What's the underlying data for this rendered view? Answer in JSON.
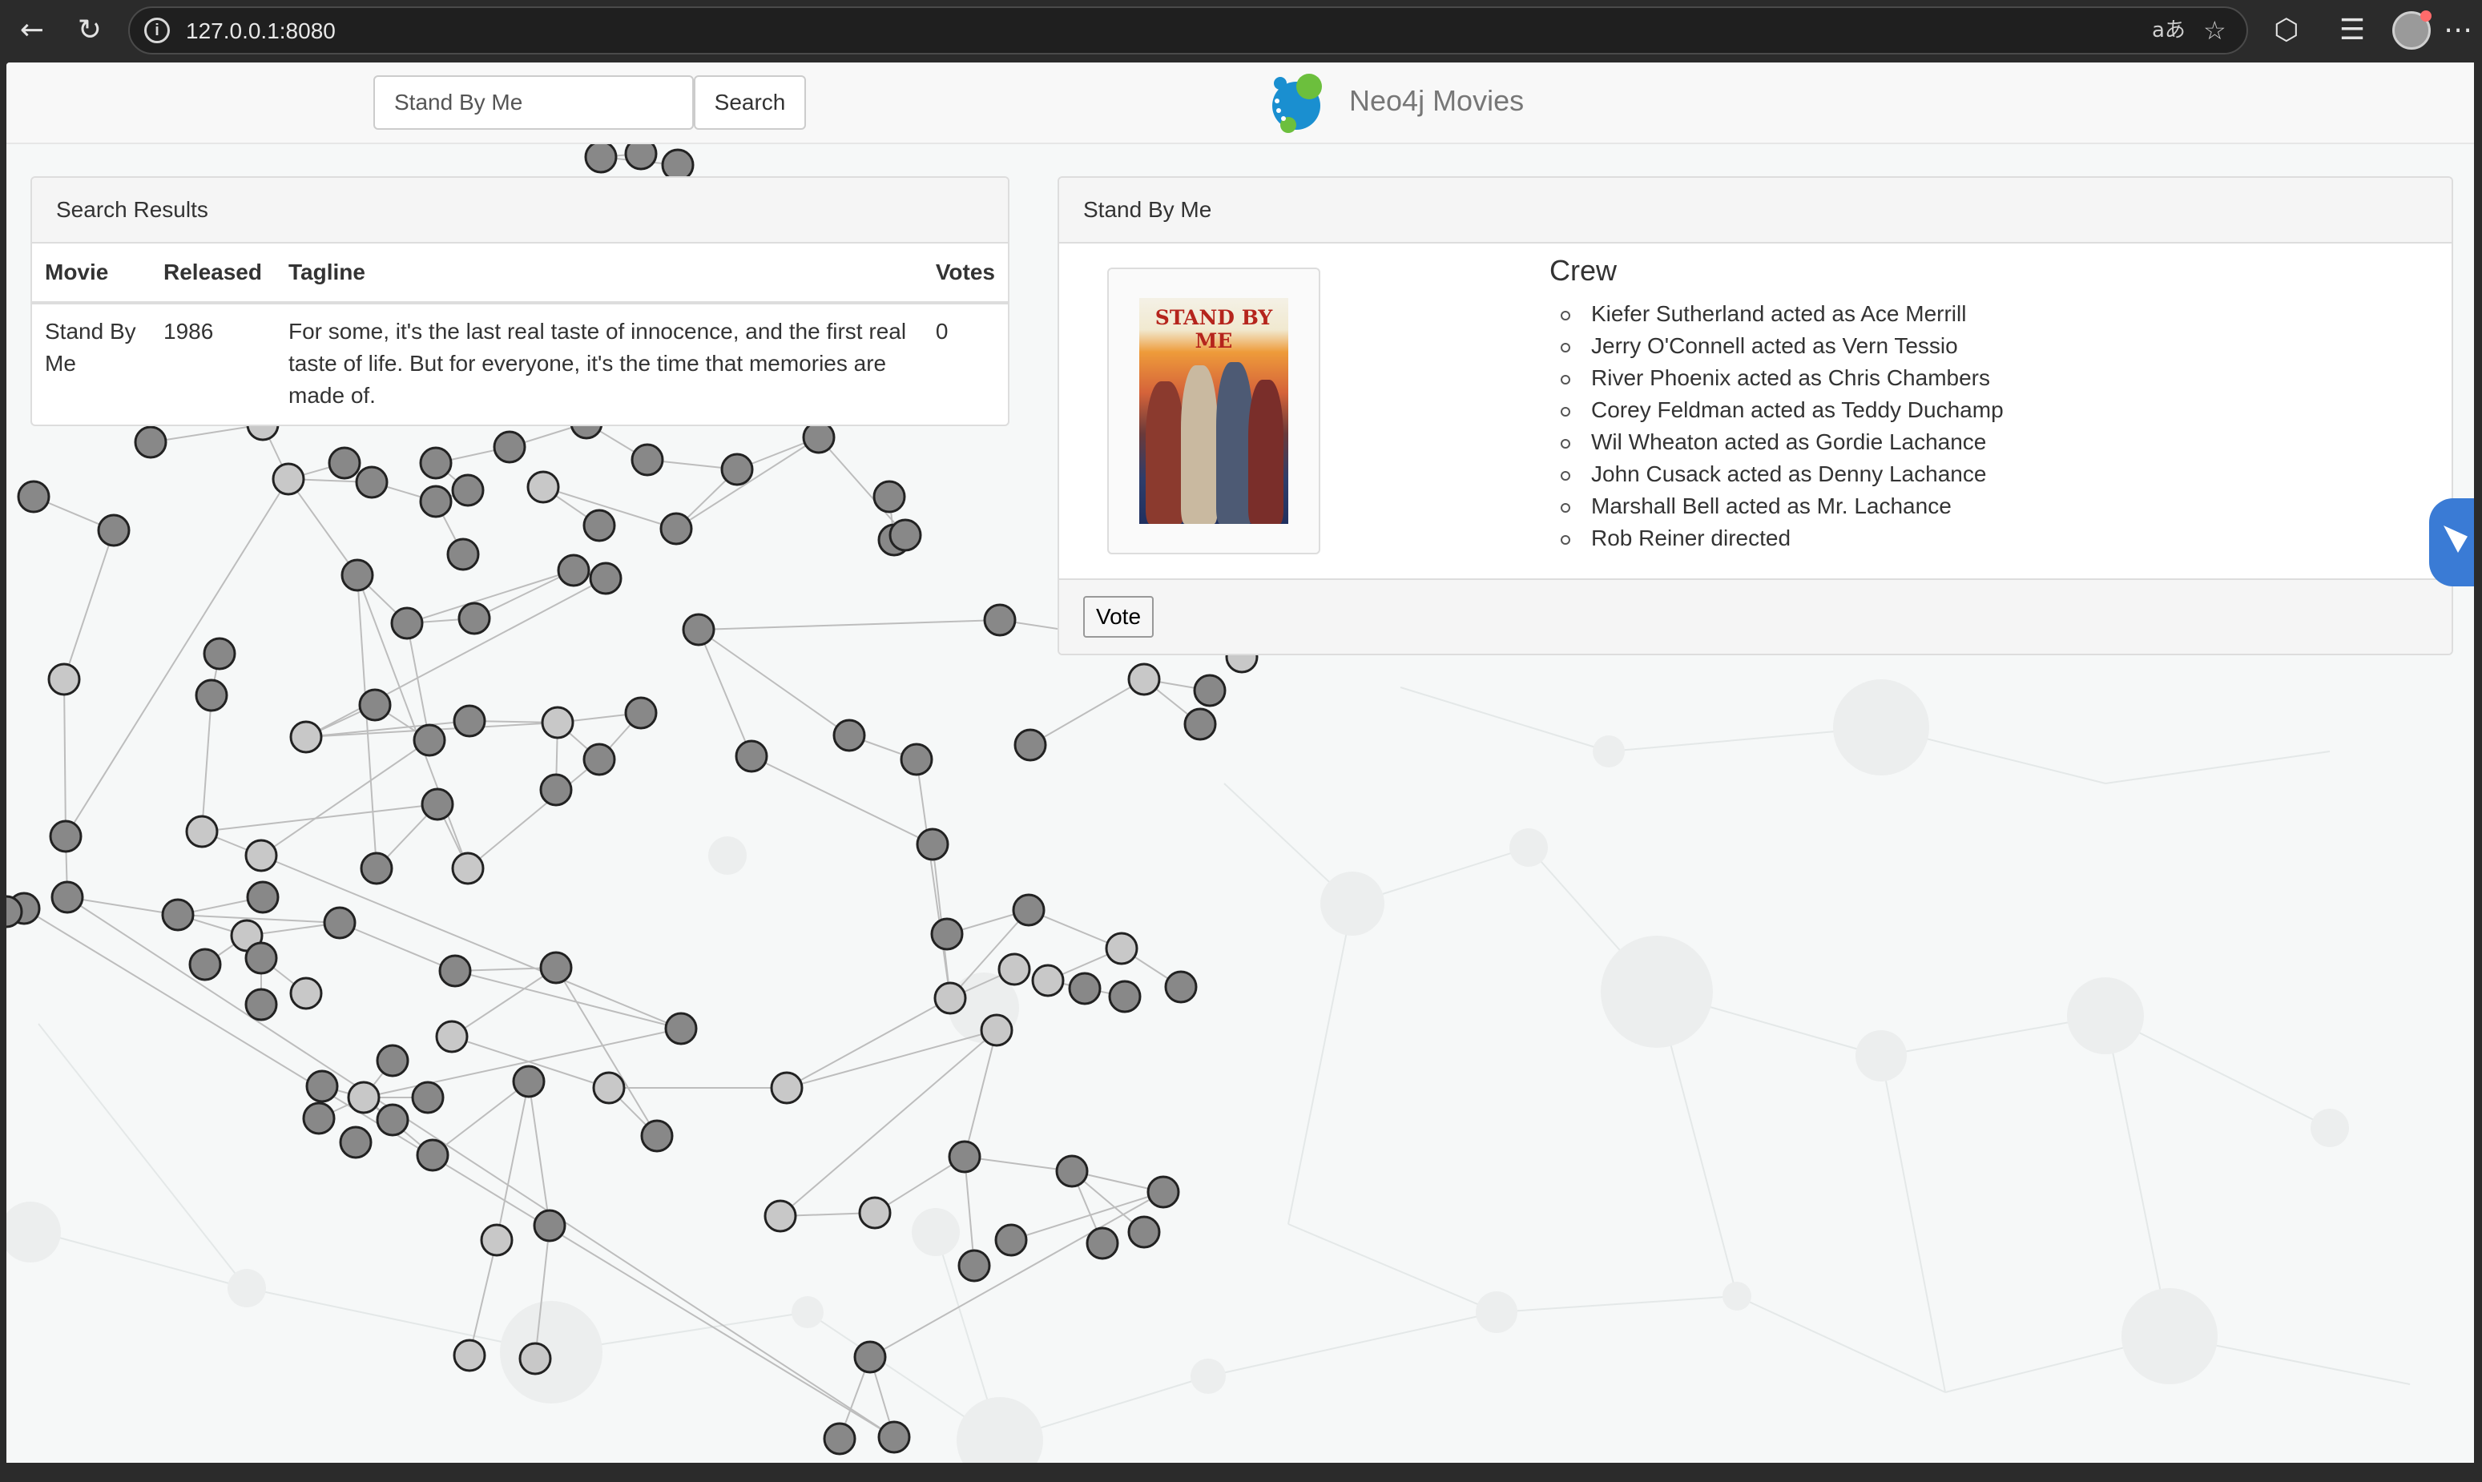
{
  "browser": {
    "url": "127.0.0.1:8080",
    "icons": [
      "back-icon",
      "reload-icon",
      "info-icon",
      "translate-icon",
      "star-icon",
      "extensions-icon",
      "favorites-icon",
      "profile-icon",
      "more-icon"
    ],
    "back_glyph": "←",
    "reload_glyph": "↻",
    "translate_glyph": "aあ",
    "star_glyph": "☆",
    "ext_glyph": "⬡",
    "fav_glyph": "☰",
    "more_glyph": "⋯"
  },
  "navbar": {
    "search_value": "Stand By Me",
    "search_button": "Search",
    "brand": "Neo4j Movies"
  },
  "results": {
    "heading": "Search Results",
    "columns": [
      "Movie",
      "Released",
      "Tagline",
      "Votes"
    ],
    "rows": [
      {
        "movie": "Stand By Me",
        "released": "1986",
        "tagline": "For some, it's the last real taste of innocence, and the first real taste of life. But for everyone, it's the time that memories are made of.",
        "votes": "0"
      }
    ]
  },
  "detail": {
    "heading": "Stand By Me",
    "poster_title": "STAND BY ME",
    "crew_title": "Crew",
    "crew": [
      "Kiefer Sutherland acted as Ace Merrill",
      "Jerry O'Connell acted as Vern Tessio",
      "River Phoenix acted as Chris Chambers",
      "Corey Feldman acted as Teddy Duchamp",
      "Wil Wheaton acted as Gordie Lachance",
      "John Cusack acted as Denny Lachance",
      "Marshall Bell acted as Mr. Lachance",
      "Rob Reiner directed"
    ],
    "vote_button": "Vote"
  },
  "colors": {
    "movie_node": "#c8c8c8",
    "person_node": "#888888",
    "edge": "#bdbdbd",
    "background": "#f6f8f8"
  }
}
